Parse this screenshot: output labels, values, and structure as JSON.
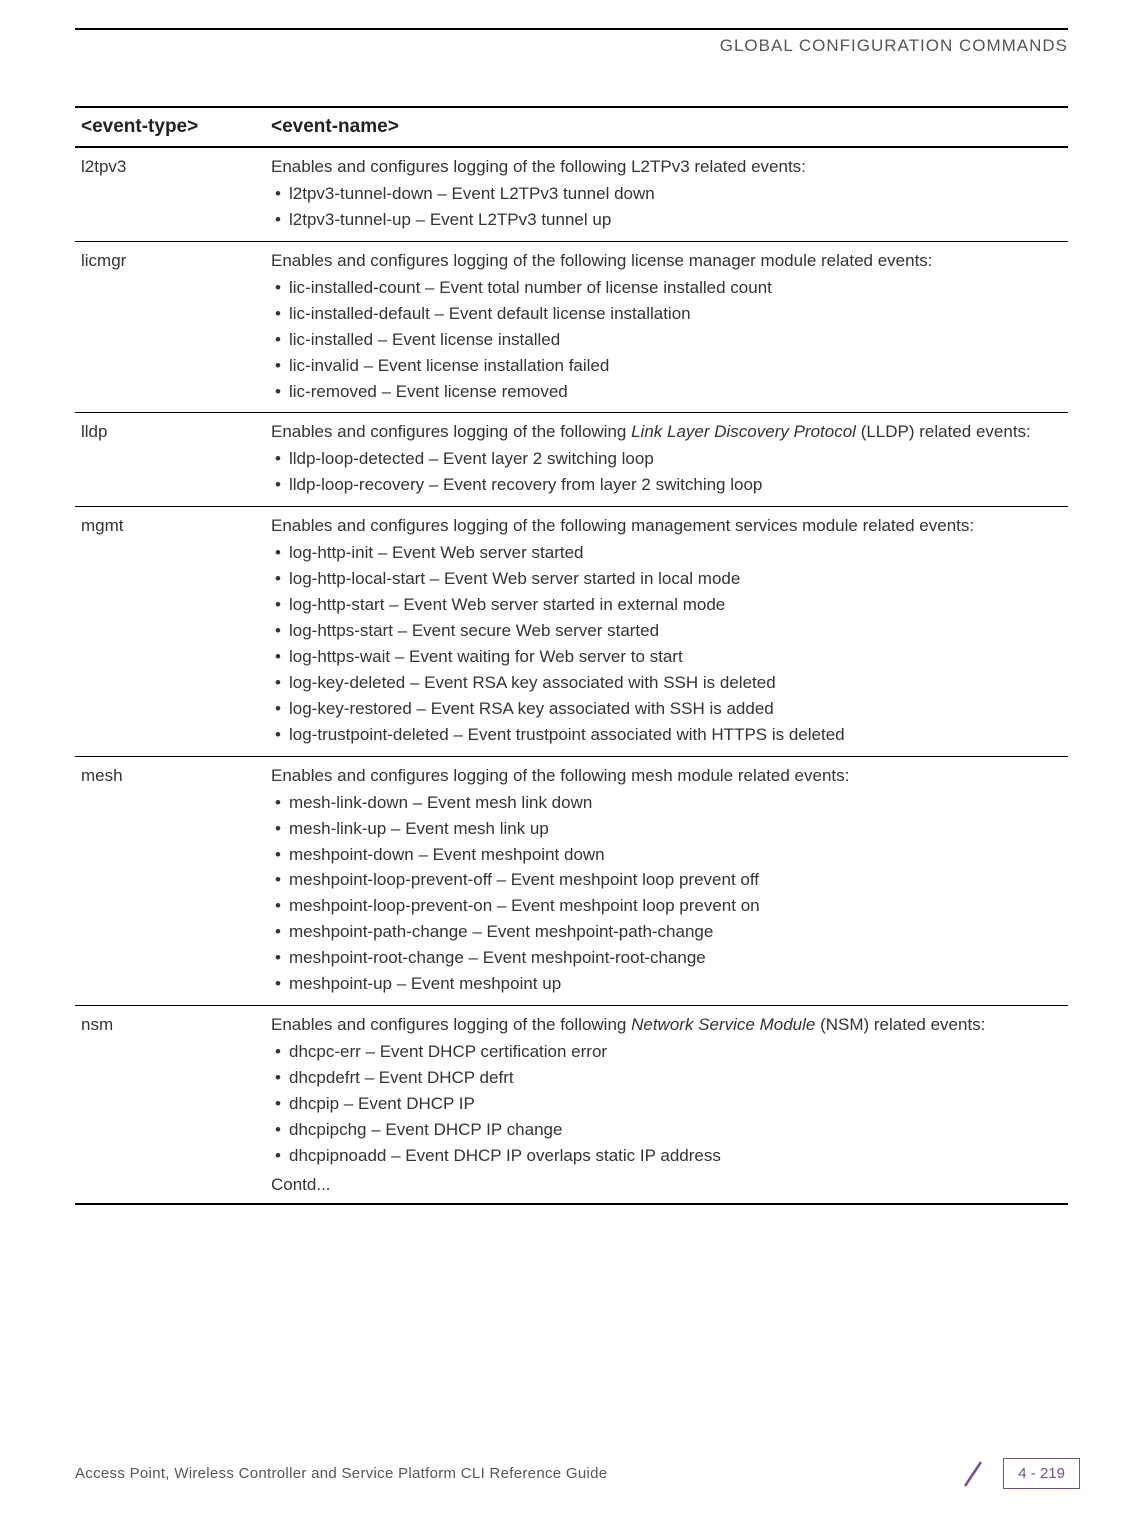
{
  "header": {
    "title": "GLOBAL CONFIGURATION COMMANDS"
  },
  "table": {
    "headers": {
      "col1": "<event-type>",
      "col2": "<event-name>"
    },
    "rows": [
      {
        "type": "l2tpv3",
        "intro": "Enables and configures logging of the following L2TPv3 related events:",
        "items": [
          "l2tpv3-tunnel-down – Event L2TPv3 tunnel down",
          "l2tpv3-tunnel-up – Event L2TPv3 tunnel up"
        ]
      },
      {
        "type": "licmgr",
        "intro": "Enables and configures logging of the following license manager module related events:",
        "items": [
          "lic-installed-count – Event total number of license installed count",
          "lic-installed-default – Event default license installation",
          "lic-installed – Event license installed",
          "lic-invalid – Event license installation failed",
          "lic-removed – Event license removed"
        ]
      },
      {
        "type": "lldp",
        "intro_html": "Enables and configures logging of the following <em>Link Layer Discovery Protocol</em> (LLDP) related events:",
        "items": [
          "lldp-loop-detected – Event layer 2 switching loop",
          "lldp-loop-recovery – Event recovery from layer 2 switching loop"
        ]
      },
      {
        "type": "mgmt",
        "intro": "Enables and configures logging of the following management services module related events:",
        "items": [
          "log-http-init – Event Web server started",
          "log-http-local-start – Event Web server started in local mode",
          "log-http-start – Event Web server started in external mode",
          "log-https-start – Event secure Web server started",
          "log-https-wait – Event waiting for Web server to start",
          "log-key-deleted – Event RSA key associated with SSH is deleted",
          "log-key-restored – Event RSA key associated with SSH is added",
          "log-trustpoint-deleted – Event trustpoint associated with HTTPS is deleted"
        ]
      },
      {
        "type": "mesh",
        "intro": "Enables and configures logging of the following mesh module related events:",
        "items": [
          "mesh-link-down – Event mesh link down",
          "mesh-link-up – Event mesh link up",
          "meshpoint-down – Event meshpoint down",
          "meshpoint-loop-prevent-off – Event meshpoint loop prevent off",
          "meshpoint-loop-prevent-on – Event meshpoint loop prevent on",
          "meshpoint-path-change – Event meshpoint-path-change",
          "meshpoint-root-change – Event meshpoint-root-change",
          "meshpoint-up – Event meshpoint up"
        ]
      },
      {
        "type": "nsm",
        "intro_html": "Enables and configures logging of the following <em>Network Service Module</em> (NSM) related events:",
        "items": [
          "dhcpc-err – Event DHCP certification error",
          "dhcpdefrt – Event DHCP defrt",
          "dhcpip – Event DHCP IP",
          "dhcpipchg – Event DHCP IP change",
          "dhcpipnoadd – Event DHCP IP overlaps static IP address"
        ],
        "contd": "Contd..."
      }
    ]
  },
  "footer": {
    "text": "Access Point, Wireless Controller and Service Platform CLI Reference Guide",
    "page": "4 - 219"
  }
}
